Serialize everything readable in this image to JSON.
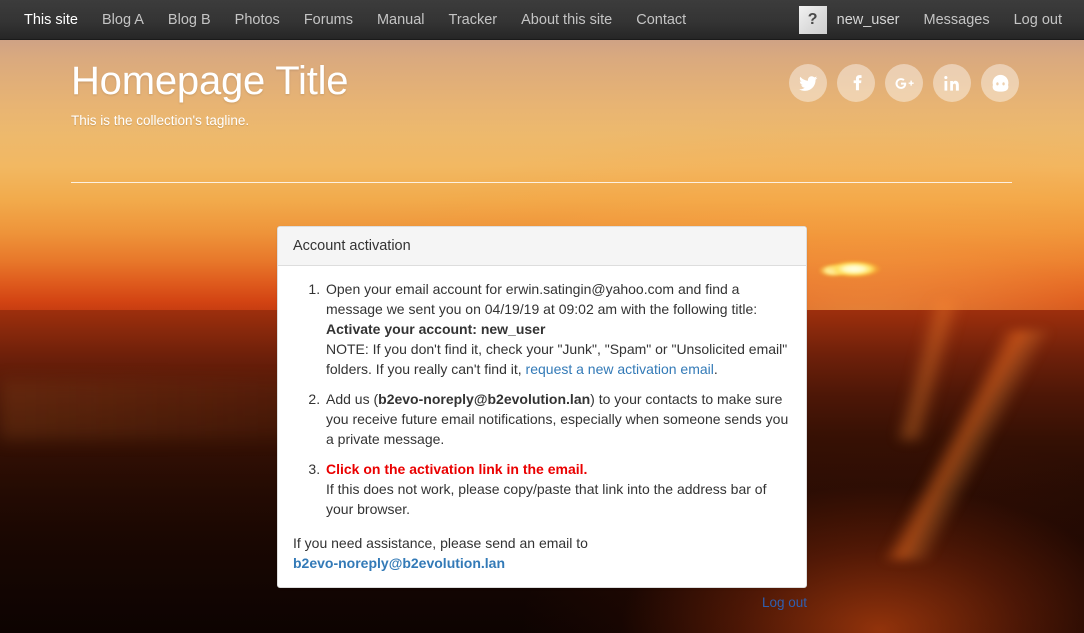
{
  "navbar": {
    "left_items": [
      {
        "label": "This site",
        "active": true
      },
      {
        "label": "Blog A",
        "active": false
      },
      {
        "label": "Blog B",
        "active": false
      },
      {
        "label": "Photos",
        "active": false
      },
      {
        "label": "Forums",
        "active": false
      },
      {
        "label": "Manual",
        "active": false
      },
      {
        "label": "Tracker",
        "active": false
      },
      {
        "label": "About this site",
        "active": false
      },
      {
        "label": "Contact",
        "active": false
      }
    ],
    "avatar_glyph": "?",
    "username": "new_user",
    "messages_label": "Messages",
    "logout_label": "Log out"
  },
  "header": {
    "title": "Homepage Title",
    "tagline": "This is the collection's tagline."
  },
  "social": [
    {
      "name": "twitter-icon"
    },
    {
      "name": "facebook-icon"
    },
    {
      "name": "google-plus-icon"
    },
    {
      "name": "linkedin-icon"
    },
    {
      "name": "github-icon"
    }
  ],
  "panel": {
    "title": "Account activation",
    "steps": {
      "step1": {
        "line1": "Open your email account for erwin.satingin@yahoo.com and find a message we sent you on 04/19/19 at 09:02 am with the following title:",
        "subject": "Activate your account: new_user",
        "note_prefix": "NOTE: If you don't find it, check your \"Junk\", \"Spam\" or \"Unsolicited email\" folders. If you really can't find it, ",
        "note_link": "request a new activation email",
        "note_suffix": "."
      },
      "step2": {
        "prefix": "Add us (",
        "email": "b2evo-noreply@b2evolution.lan",
        "suffix": ") to your contacts to make sure you receive future email notifications, especially when someone sends you a private message."
      },
      "step3": {
        "headline": "Click on the activation link in the email.",
        "detail": "If this does not work, please copy/paste that link into the address bar of your browser."
      }
    },
    "assistance": {
      "text": "If you need assistance, please send an email to",
      "email": "b2evo-noreply@b2evolution.lan"
    }
  },
  "footer": {
    "logout_label": "Log out"
  },
  "colors": {
    "navbar_bg": "#343434",
    "link": "#337ab7",
    "danger": "#ea0000",
    "panel_header_bg": "#f5f5f5",
    "footer_link": "#2f5fb0"
  }
}
